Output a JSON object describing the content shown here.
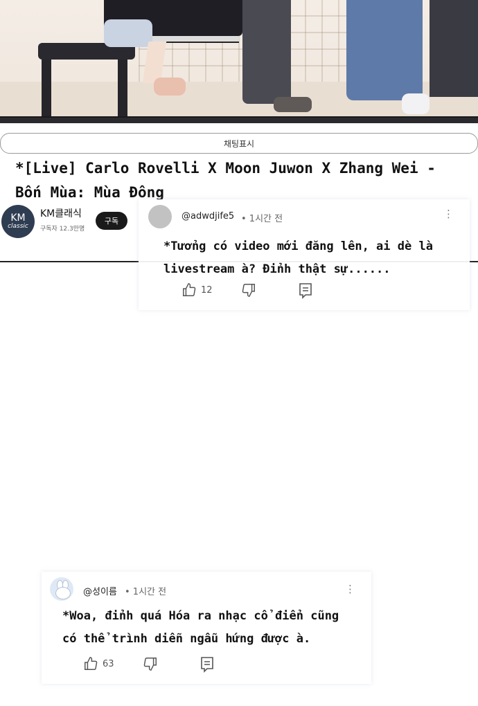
{
  "live_bar": {
    "chat_toggle_label": "채팅표시",
    "video_title_line1": "*[Live] Carlo Rovelli X Moon Juwon X Zhang Wei -",
    "video_title_line2": "Bốn Mùa: Mùa Đông",
    "channel": {
      "logo_line1": "KM",
      "logo_line2": "classic",
      "name": "KM클래식",
      "subscribers": "구독자 12.3만명",
      "subscribe_label": "구독"
    }
  },
  "comments": [
    {
      "handle": "@adwdjife5",
      "time": "• 1시간 전",
      "text_line1": "*Tưởng có video mới đăng lên, ai dè là",
      "text_line2": "livestream à? Đỉnh thật sự......",
      "likes": "12"
    },
    {
      "handle": "@성이름",
      "time": "• 1시간 전",
      "text_line1": "*Woa, đỉnh quá  Hóa ra nhạc cổ điển cũng",
      "text_line2": "có thể trình diễn ngẫu hứng được à.",
      "likes": "63"
    }
  ],
  "icons": {
    "like": "thumbs-up-icon",
    "dislike": "thumbs-down-icon",
    "reply": "reply-icon",
    "menu": "more-vert-icon"
  }
}
